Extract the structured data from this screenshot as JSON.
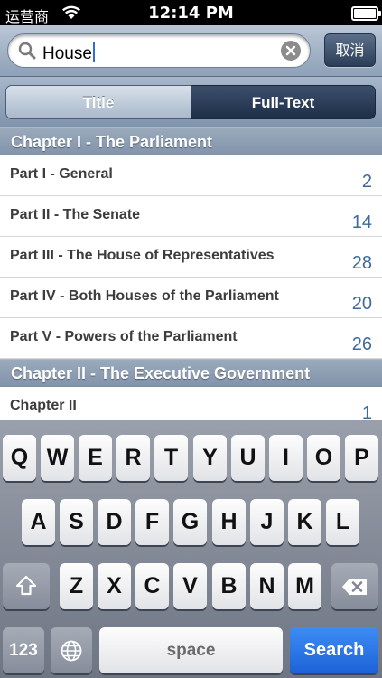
{
  "status_bar": {
    "carrier": "运营商",
    "wifi_icon": "wifi-icon",
    "time": "12:14 PM",
    "battery_icon": "battery-icon",
    "battery_level": 1.0
  },
  "search": {
    "query": "House",
    "icon": "search-icon",
    "clear_icon": "clear-icon",
    "cancel_label": "取消"
  },
  "segments": {
    "title": "Title",
    "full_text": "Full-Text",
    "selected": "Full-Text"
  },
  "sections": [
    {
      "header": "Chapter I - The Parliament",
      "rows": [
        {
          "label": "Part I - General",
          "count": "2"
        },
        {
          "label": "Part II - The Senate",
          "count": "14"
        },
        {
          "label": "Part III - The House of Representatives",
          "count": "28"
        },
        {
          "label": "Part IV - Both Houses of the Parliament",
          "count": "20"
        },
        {
          "label": "Part V - Powers of the Parliament",
          "count": "26"
        }
      ]
    },
    {
      "header": "Chapter II - The Executive Government",
      "rows": [
        {
          "label": "Chapter II",
          "count": "1"
        }
      ]
    }
  ],
  "keyboard": {
    "row1": [
      "Q",
      "W",
      "E",
      "R",
      "T",
      "Y",
      "U",
      "I",
      "O",
      "P"
    ],
    "row2": [
      "A",
      "S",
      "D",
      "F",
      "G",
      "H",
      "J",
      "K",
      "L"
    ],
    "row3": [
      "Z",
      "X",
      "C",
      "V",
      "B",
      "N",
      "M"
    ],
    "shift_icon": "shift-icon",
    "delete_icon": "delete-icon",
    "globe_icon": "globe-icon",
    "numbers_label": "123",
    "space_label": "space",
    "search_label": "Search"
  },
  "colors": {
    "count_text": "#3d6aa0",
    "search_key": "#2a74e8",
    "selected_segment": "#2a3c58"
  }
}
